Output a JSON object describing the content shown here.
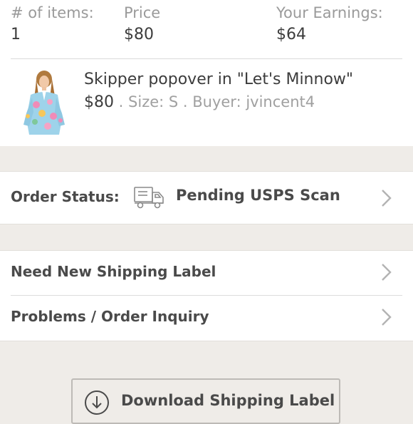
{
  "summary": {
    "items_label": "# of items:",
    "items_value": "1",
    "price_label": "Price",
    "price_value": "$80",
    "earnings_label": "Your Earnings:",
    "earnings_value": "$64"
  },
  "item": {
    "title": "Skipper popover in \"Let's Minnow\"",
    "price": "$80",
    "size": " . Size: S",
    "buyer": " . Buyer: jvincent4"
  },
  "order_status": {
    "label": "Order Status:",
    "icon": "truck-icon",
    "value": "Pending USPS Scan"
  },
  "actions": {
    "shipping_label": "Need New Shipping Label",
    "problems": "Problems / Order Inquiry"
  },
  "download_button": {
    "label": "Download Shipping Label",
    "icon": "download-circle-icon"
  }
}
